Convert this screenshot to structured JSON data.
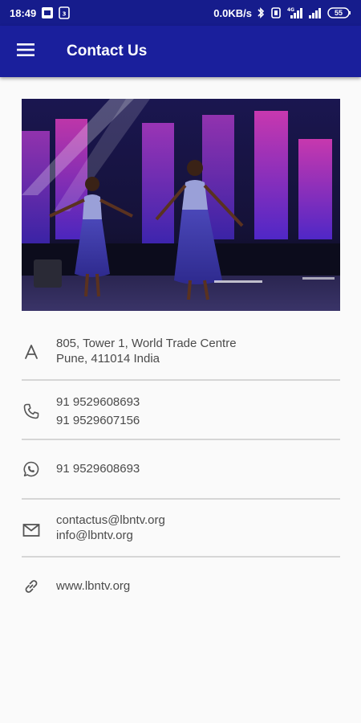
{
  "status_bar": {
    "time": "18:49",
    "net_speed": "0.0KB/s",
    "battery": "55"
  },
  "app_bar": {
    "title": "Contact Us",
    "menu_icon": "hamburger-icon"
  },
  "hero_image": {
    "description_icon": "photo"
  },
  "contacts": {
    "address": {
      "icon": "address-icon",
      "line1": "805, Tower 1, World Trade Centre",
      "line2": "Pune, 411014 India"
    },
    "phone": {
      "icon": "phone-icon",
      "line1": "91 9529608693",
      "line2": "91 9529607156"
    },
    "whatsapp": {
      "icon": "whatsapp-icon",
      "line1": "91 9529608693"
    },
    "email": {
      "icon": "mail-icon",
      "line1": "contactus@lbntv.org",
      "line2": "info@lbntv.org"
    },
    "website": {
      "icon": "link-icon",
      "line1": "www.lbntv.org"
    }
  },
  "colors": {
    "app_bar": "#1a1f9c",
    "status_bar": "#161c8c",
    "background": "#fafafa",
    "divider": "#d6d6d6"
  }
}
